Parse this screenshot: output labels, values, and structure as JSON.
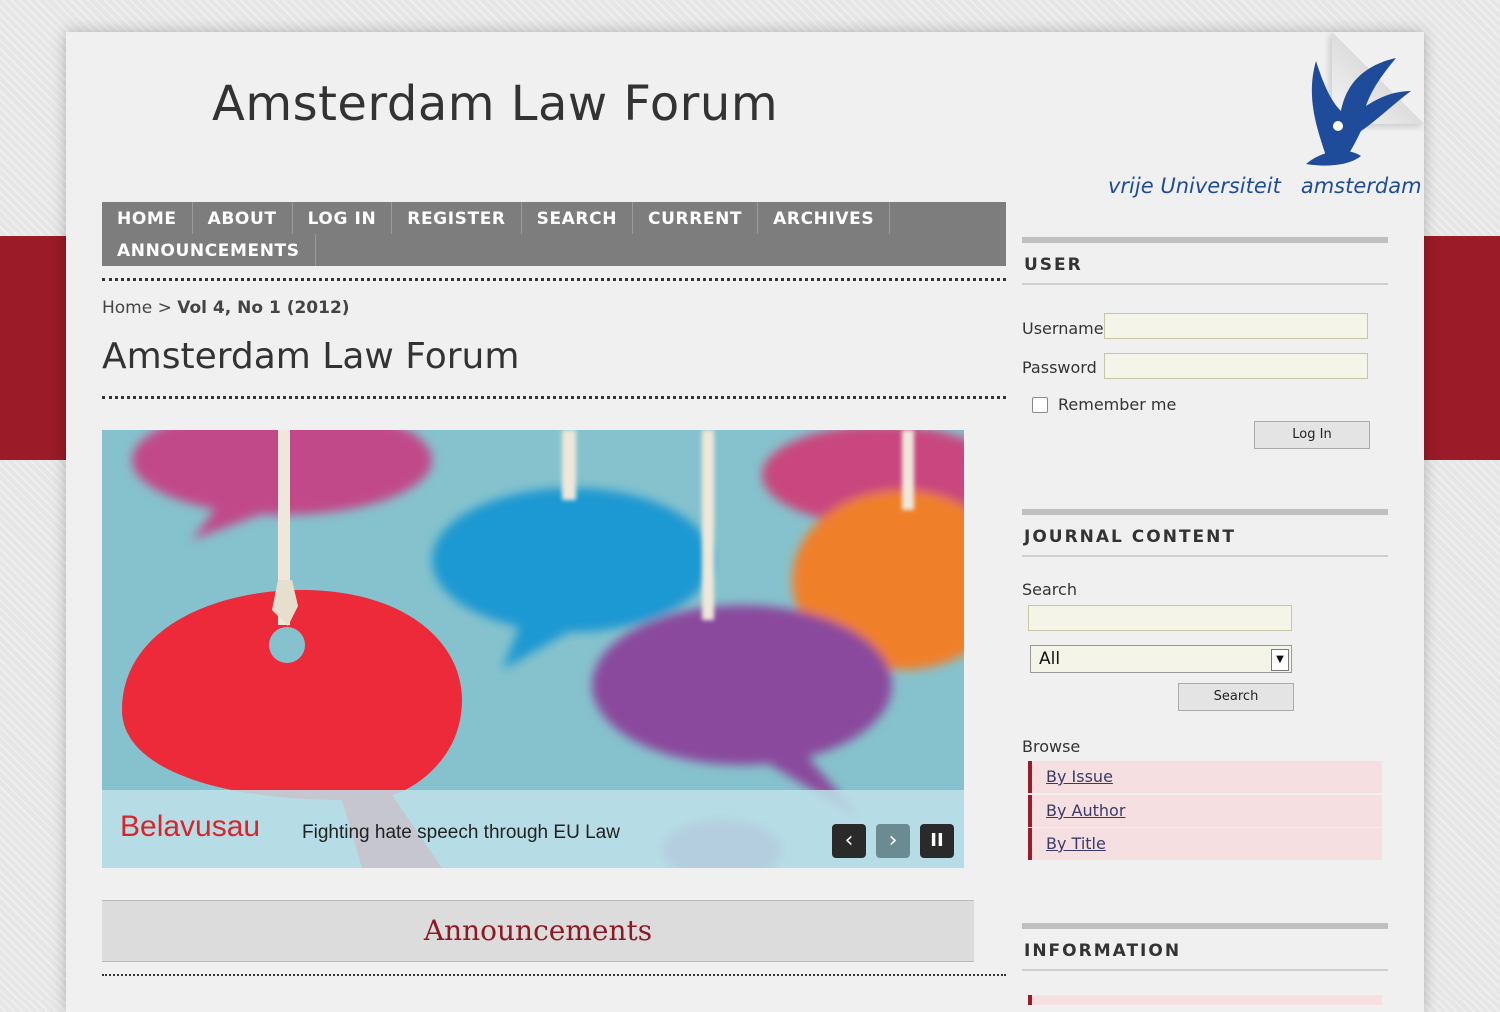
{
  "site": {
    "title": "Amsterdam Law Forum",
    "logo_text_left": "vrije Universiteit",
    "logo_text_right": "amsterdam"
  },
  "nav": {
    "items": [
      "HOME",
      "ABOUT",
      "LOG IN",
      "REGISTER",
      "SEARCH",
      "CURRENT",
      "ARCHIVES",
      "ANNOUNCEMENTS"
    ]
  },
  "breadcrumb": {
    "home": "Home",
    "separator": ">",
    "current": "Vol 4, No 1 (2012)"
  },
  "main": {
    "page_title": "Amsterdam Law Forum",
    "slider": {
      "author": "Belavusau",
      "title": "Fighting hate speech through EU Law",
      "prev": "‹",
      "next": "›",
      "pause": "II"
    },
    "announcements_heading": "Announcements"
  },
  "sidebar": {
    "user": {
      "heading": "USER",
      "username_label": "Username",
      "username_value": "",
      "password_label": "Password",
      "password_value": "",
      "remember_label": "Remember me",
      "login_button": "Log In"
    },
    "journal_content": {
      "heading": "JOURNAL CONTENT",
      "search_label": "Search",
      "search_value": "",
      "scope_selected": "All",
      "search_button": "Search",
      "browse_label": "Browse",
      "browse_links": [
        "By Issue",
        "By Author",
        "By Title"
      ]
    },
    "information": {
      "heading": "INFORMATION"
    }
  },
  "colors": {
    "brand_red": "#9b1b28",
    "nav_grey": "#7d7d7d",
    "logo_blue": "#1f4c9a"
  }
}
